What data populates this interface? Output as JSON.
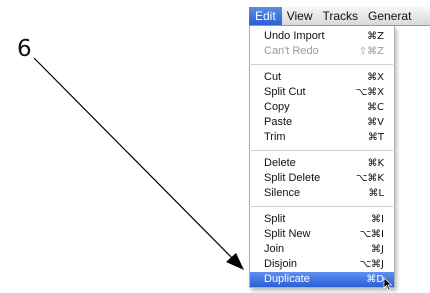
{
  "callout": {
    "number": "6"
  },
  "menubar": {
    "items": [
      {
        "label": "Edit",
        "active": true
      },
      {
        "label": "View",
        "active": false
      },
      {
        "label": "Tracks",
        "active": false
      },
      {
        "label": "Generat",
        "active": false
      }
    ]
  },
  "edit_menu": {
    "groups": [
      [
        {
          "label": "Undo Import",
          "shortcut": "⌘Z",
          "enabled": true
        },
        {
          "label": "Can't Redo",
          "shortcut": "⇧⌘Z",
          "enabled": false
        }
      ],
      [
        {
          "label": "Cut",
          "shortcut": "⌘X",
          "enabled": true
        },
        {
          "label": "Split Cut",
          "shortcut": "⌥⌘X",
          "enabled": true
        },
        {
          "label": "Copy",
          "shortcut": "⌘C",
          "enabled": true
        },
        {
          "label": "Paste",
          "shortcut": "⌘V",
          "enabled": true
        },
        {
          "label": "Trim",
          "shortcut": "⌘T",
          "enabled": true
        }
      ],
      [
        {
          "label": "Delete",
          "shortcut": "⌘K",
          "enabled": true
        },
        {
          "label": "Split Delete",
          "shortcut": "⌥⌘K",
          "enabled": true
        },
        {
          "label": "Silence",
          "shortcut": "⌘L",
          "enabled": true
        }
      ],
      [
        {
          "label": "Split",
          "shortcut": "⌘I",
          "enabled": true
        },
        {
          "label": "Split New",
          "shortcut": "⌥⌘I",
          "enabled": true
        },
        {
          "label": "Join",
          "shortcut": "⌘J",
          "enabled": true
        },
        {
          "label": "Disjoin",
          "shortcut": "⌥⌘J",
          "enabled": true
        },
        {
          "label": "Duplicate",
          "shortcut": "⌘D",
          "enabled": true,
          "selected": true
        }
      ]
    ]
  },
  "colors": {
    "highlight": "#2a5fd6",
    "disabled_text": "#9a9a9a",
    "arrow": "#000000"
  },
  "icons": {
    "cursor": "mouse-pointer-icon"
  }
}
